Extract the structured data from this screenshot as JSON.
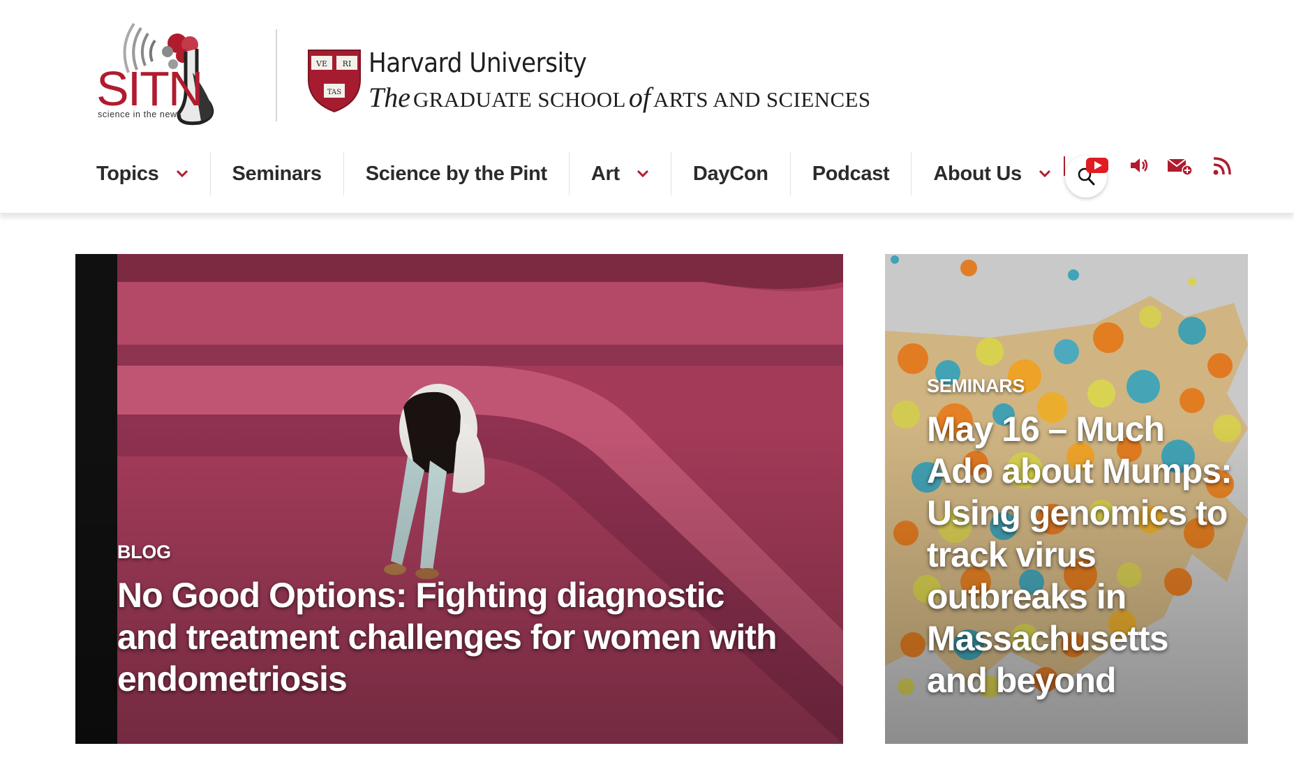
{
  "logos": {
    "sitn_text": "SITN",
    "sitn_tagline": "science in the news",
    "harvard_title": "Harvard University",
    "shield_labels": [
      "VE",
      "RI",
      "TAS"
    ],
    "gsas_the": "The",
    "gsas_part1": "GRADUATE SCHOOL",
    "gsas_of": "of",
    "gsas_part2": "ARTS AND SCIENCES"
  },
  "nav": {
    "items": [
      {
        "label": "Topics",
        "dropdown": true
      },
      {
        "label": "Seminars",
        "dropdown": false
      },
      {
        "label": "Science by the Pint",
        "dropdown": false
      },
      {
        "label": "Art",
        "dropdown": true
      },
      {
        "label": "DayCon",
        "dropdown": false
      },
      {
        "label": "Podcast",
        "dropdown": false
      },
      {
        "label": "About Us",
        "dropdown": true
      }
    ],
    "icons": [
      "search-icon",
      "youtube-icon",
      "sound-icon",
      "mail-subscribe-icon",
      "rss-icon"
    ]
  },
  "colors": {
    "brand_red": "#b01c2e",
    "main_card_bg": "#a13a57",
    "side_card_bg": "#c8c8c8",
    "nav_text": "#2b2b2b"
  },
  "featured": {
    "main": {
      "category": "BLOG",
      "title": "No Good Options: Fighting diagnostic and treatment challenges for women with endometriosis"
    },
    "side": {
      "category": "SEMINARS",
      "title": "May 16 – Much Ado about Mumps: Using genomics to track virus outbreaks in Massachusetts and beyond"
    }
  }
}
